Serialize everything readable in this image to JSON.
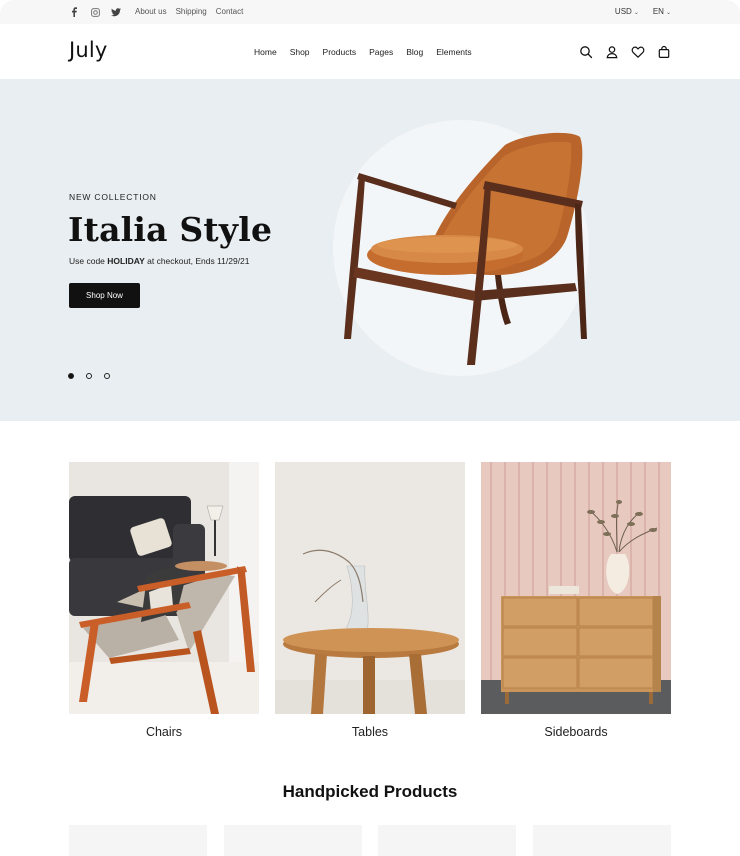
{
  "topbar": {
    "social_icons": [
      "facebook-icon",
      "instagram-icon",
      "twitter-icon"
    ],
    "links": [
      "About us",
      "Shipping",
      "Contact"
    ],
    "currency": "USD",
    "language": "EN"
  },
  "header": {
    "logo": "July",
    "nav": [
      "Home",
      "Shop",
      "Products",
      "Pages",
      "Blog",
      "Elements"
    ],
    "icons": [
      "search-icon",
      "account-icon",
      "wishlist-icon",
      "cart-icon"
    ]
  },
  "hero": {
    "kicker": "NEW COLLECTION",
    "title": "Italia Style",
    "promo_prefix": "Use code ",
    "promo_code": "HOLIDAY",
    "promo_suffix": " at checkout, Ends 11/29/21",
    "button": "Shop Now",
    "slides": 3,
    "active_slide": 1,
    "background": "#e9eef2"
  },
  "categories": [
    {
      "label": "Chairs"
    },
    {
      "label": "Tables"
    },
    {
      "label": "Sideboards"
    }
  ],
  "handpicked": {
    "title": "Handpicked Products"
  }
}
